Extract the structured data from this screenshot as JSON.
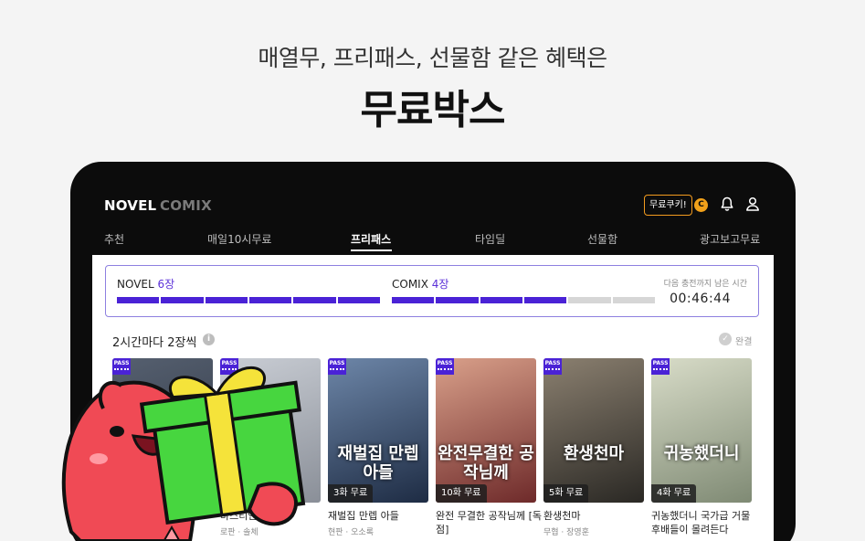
{
  "promo": {
    "headline": "매열무, 프리패스, 선물함 같은 혜택은",
    "title": "무료박스"
  },
  "header": {
    "brand_novel": "NOVEL",
    "brand_comix": "COMIX",
    "cookie_button": "무료쿠키!",
    "cookie_icon_text": "C"
  },
  "tabs": [
    {
      "label": "추천"
    },
    {
      "label": "매일10시무료"
    },
    {
      "label": "프리패스",
      "active": true
    },
    {
      "label": "타임딜"
    },
    {
      "label": "선물함"
    },
    {
      "label": "광고보고무료"
    }
  ],
  "pass": {
    "novel_label": "NOVEL",
    "novel_count": "6장",
    "novel_filled": 6,
    "novel_total": 6,
    "comix_label": "COMIX",
    "comix_count": "4장",
    "comix_filled": 4,
    "comix_total": 6,
    "timer_label": "다음 충전까지 남은 시간",
    "timer": "00:46:44"
  },
  "section": {
    "title": "2시간마다 2장씩",
    "done_label": "완결"
  },
  "pass_tag": "PASS",
  "items": [
    {
      "title": "",
      "author": "",
      "badge": "",
      "cover_text": "",
      "colors": [
        "#2b3340",
        "#566070"
      ]
    },
    {
      "title": "바스티안 [독점]",
      "author": "로판 · 솔체",
      "badge": "",
      "cover_text": "",
      "colors": [
        "#8a8f98",
        "#c9cdd4"
      ]
    },
    {
      "title": "재벌집 만렙 아들",
      "author": "현판 · 오소록",
      "badge": "3화 무료",
      "cover_text": "재벌집 만렙 아들",
      "colors": [
        "#1e2c44",
        "#6d86a8"
      ]
    },
    {
      "title": "완전 무결한 공작님께 [독점]",
      "author": "",
      "badge": "10화 무료",
      "cover_text": "완전무결한 공작님께",
      "colors": [
        "#6e2a2a",
        "#d9a08a"
      ]
    },
    {
      "title": "환생천마",
      "author": "무협 · 장영훈",
      "badge": "5화 무료",
      "cover_text": "환생천마",
      "colors": [
        "#2a2824",
        "#8b8070"
      ]
    },
    {
      "title": "귀농했더니 국가급 거물 후배들이 몰려든다",
      "author": "",
      "badge": "4화 무료",
      "cover_text": "귀농했더니",
      "colors": [
        "#7f8a74",
        "#d8dcc8"
      ]
    }
  ],
  "colors": {
    "accent": "#4a22d6",
    "cookie": "#f2a11a",
    "mascot_red": "#f04a55",
    "gift_green": "#47d63f",
    "ribbon_yellow": "#f5e33a"
  }
}
